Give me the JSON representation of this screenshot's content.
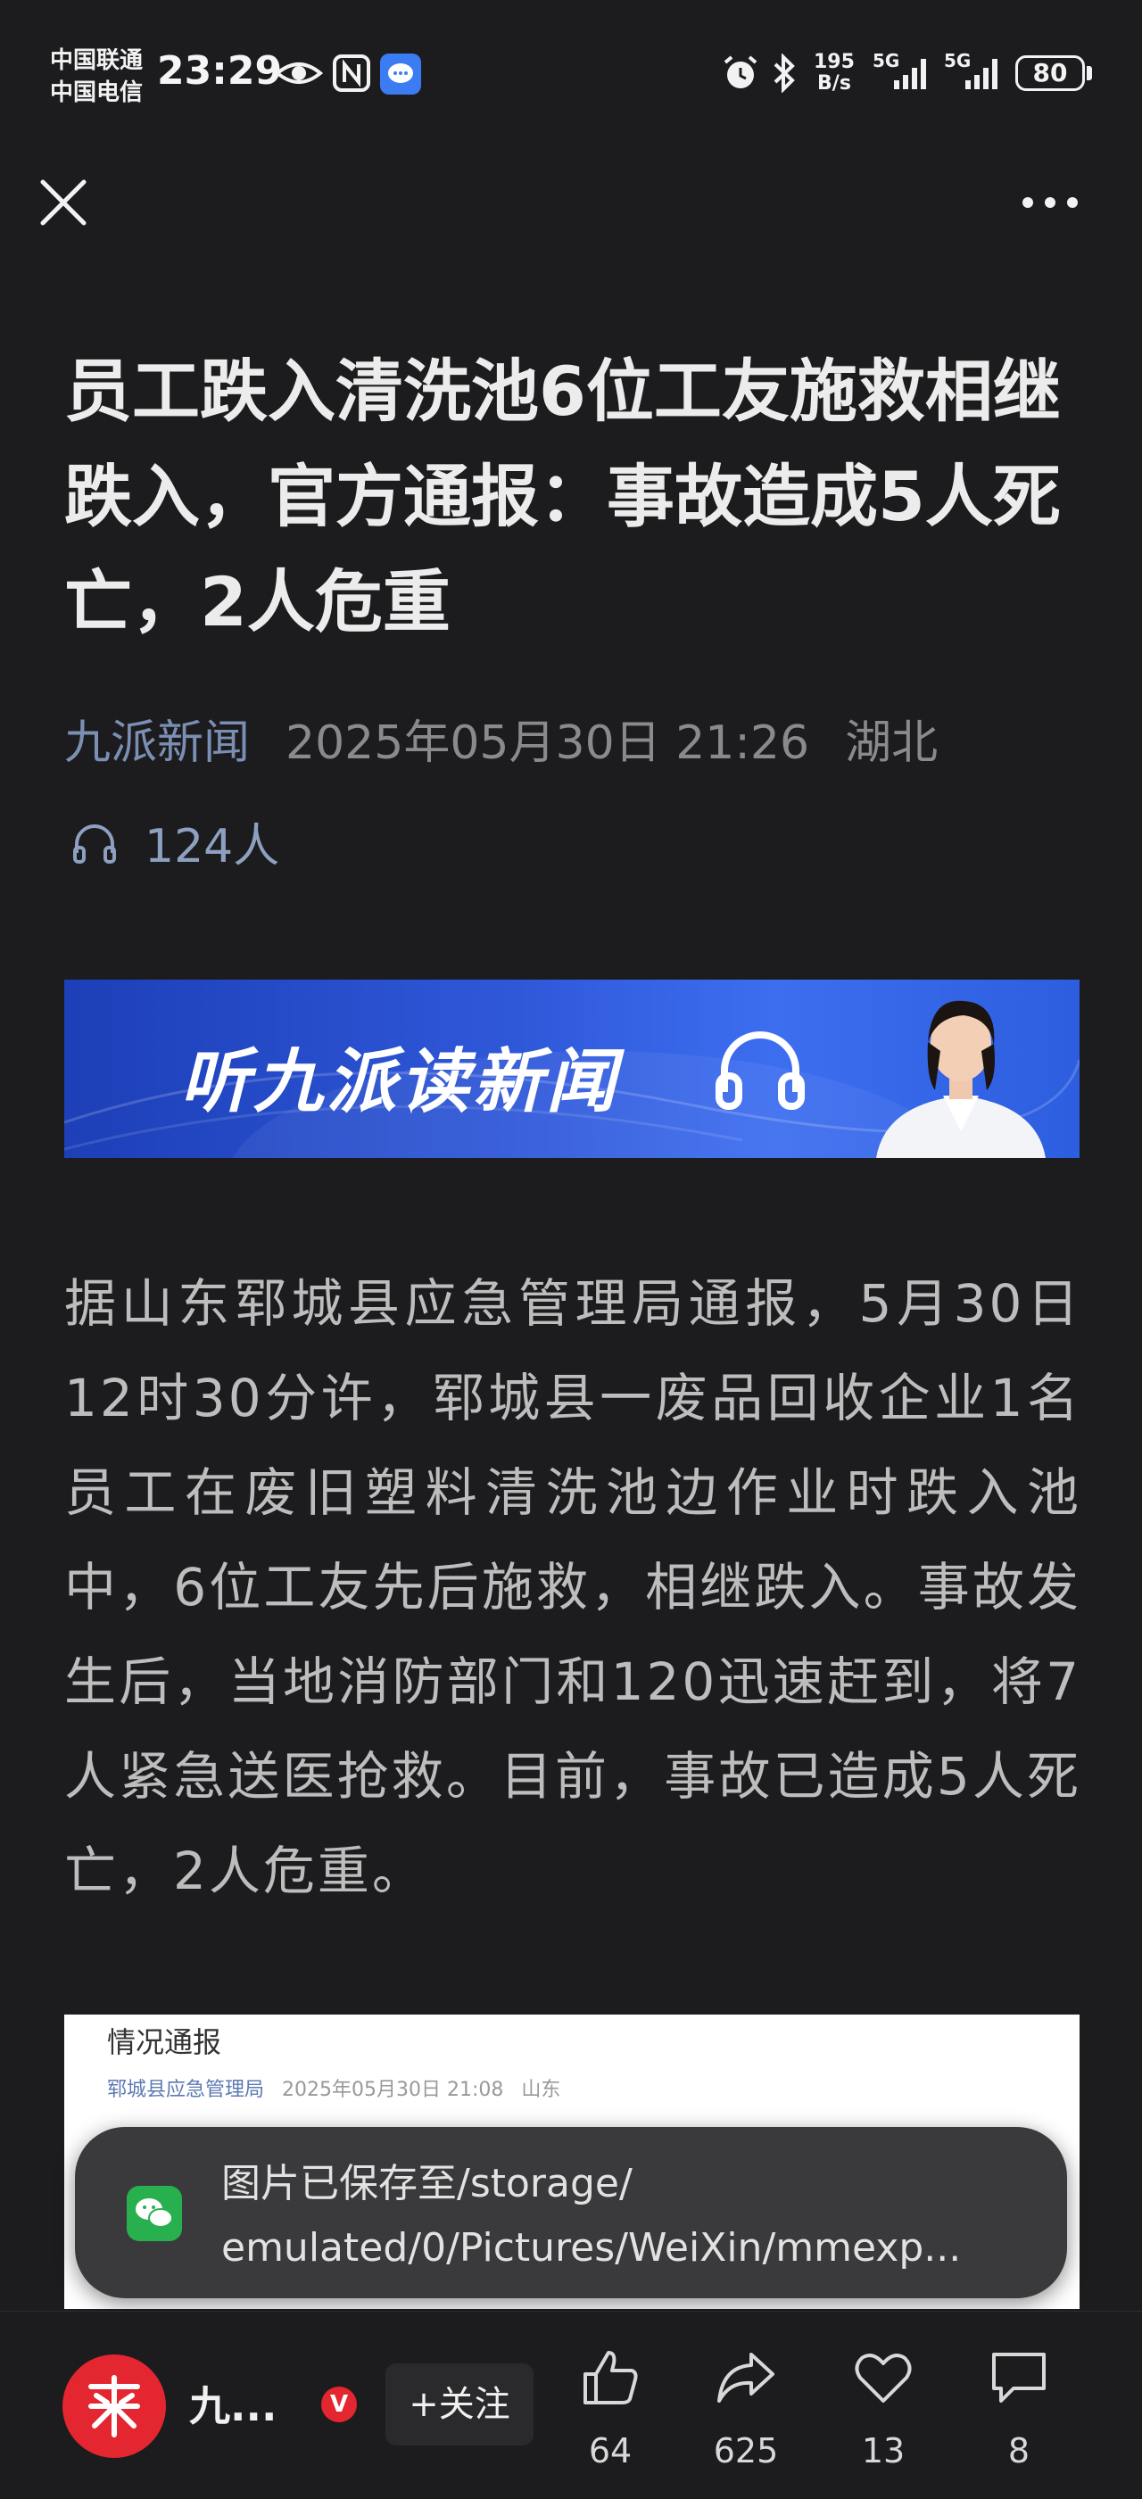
{
  "status_bar": {
    "carrier1": "中国联通",
    "carrier2": "中国电信",
    "time": "23:29",
    "speed_value": "195",
    "speed_unit": "B/s",
    "network1": "5G",
    "network2": "5G",
    "battery": "80"
  },
  "article": {
    "title": "员工跌入清洗池6位工友施救相继跌入，官方通报：事故造成5人死亡，2人危重",
    "source": "九派新闻",
    "datetime": "2025年05月30日 21:26",
    "location": "湖北",
    "listeners": "124人",
    "banner_text": "听九派读新闻",
    "body": "据山东郓城县应急管理局通报，5月30日12时30分许，郓城县一废品回收企业1名员工在废旧塑料清洗池边作业时跌入池中，6位工友先后施救，相继跌入。事故发生后，当地消防部门和120迅速赶到，将7人紧急送医抢救。目前，事故已造成5人死亡，2人危重。"
  },
  "notice_image": {
    "title": "情况通报",
    "source": "郓城县应急管理局",
    "datetime": "2025年05月30日 21:08",
    "location": "山东"
  },
  "toast": {
    "line1": "图片已保存至/storage/",
    "line2": "emulated/0/Pictures/WeiXin/mmexp..."
  },
  "bottom_bar": {
    "author": "九...",
    "verified": "V",
    "follow_label": "+关注",
    "likes": "64",
    "shares": "625",
    "favorites": "13",
    "comments": "8"
  },
  "colors": {
    "background": "#1c1c1e",
    "source_link": "#7a8fb3",
    "brand_red": "#e3262f",
    "banner_blue": "#2f58d9"
  }
}
